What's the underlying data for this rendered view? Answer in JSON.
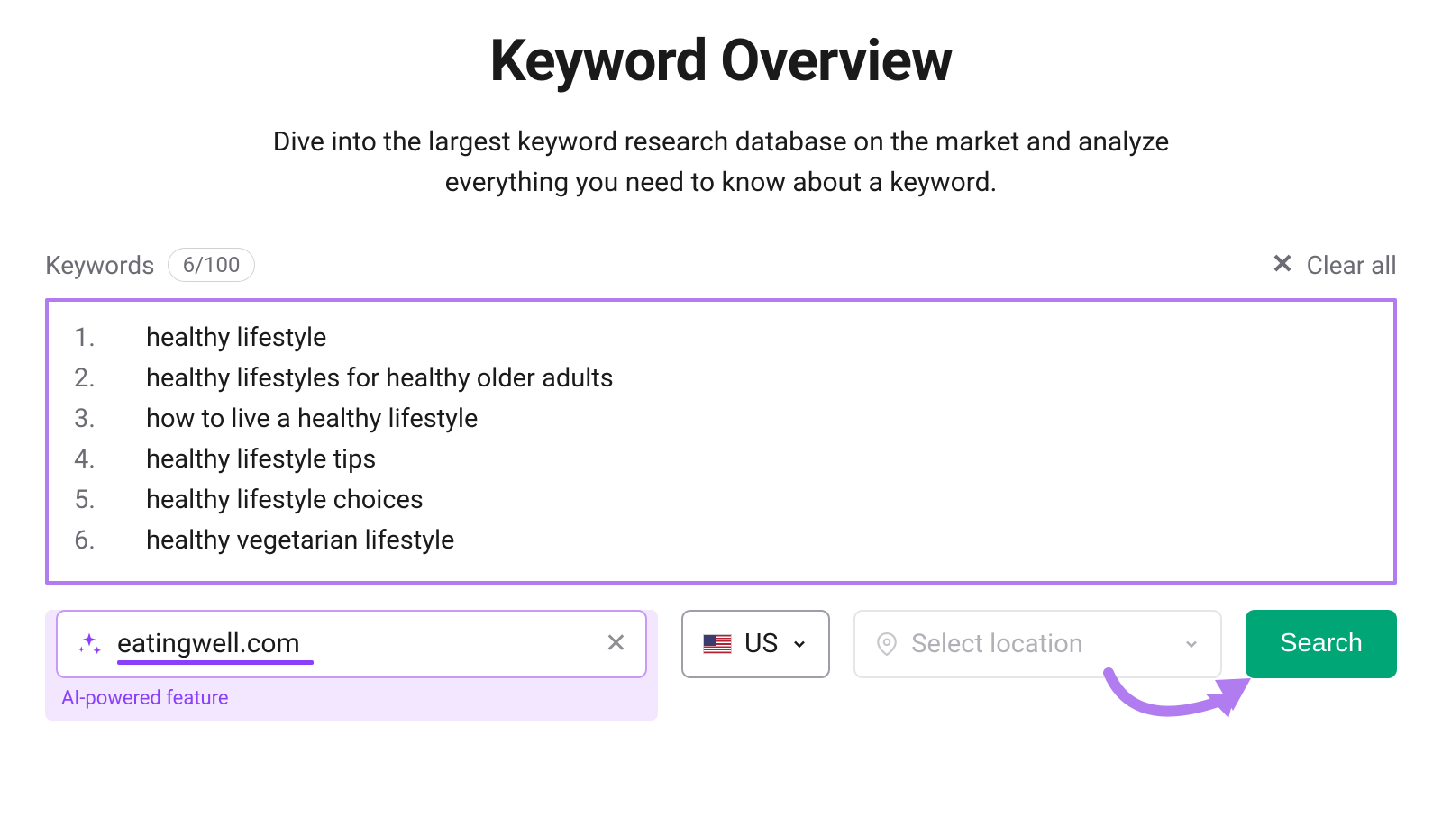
{
  "header": {
    "title": "Keyword Overview",
    "subtitle": "Dive into the largest keyword research database on the market and analyze everything you need to know about a keyword."
  },
  "keywords": {
    "label": "Keywords",
    "count": "6/100",
    "clear_label": "Clear all",
    "items": [
      "healthy lifestyle",
      "healthy lifestyles for healthy older adults",
      "how to live a healthy lifestyle",
      "healthy lifestyle tips",
      "healthy lifestyle choices",
      "healthy vegetarian lifestyle"
    ]
  },
  "domain_input": {
    "value": "eatingwell.com",
    "ai_label": "AI-powered feature"
  },
  "country": {
    "code": "US"
  },
  "location": {
    "placeholder": "Select location"
  },
  "search": {
    "label": "Search"
  }
}
